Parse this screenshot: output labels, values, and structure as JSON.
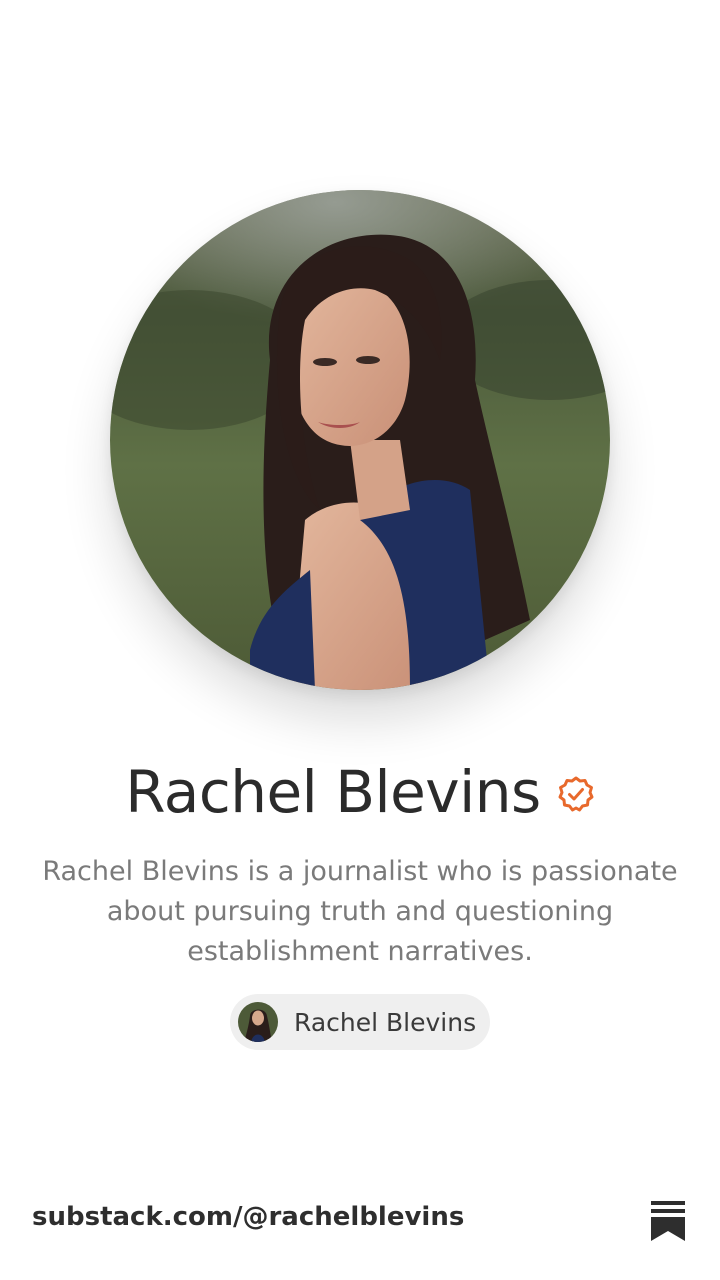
{
  "profile": {
    "name": "Rachel Blevins",
    "bio": "Rachel Blevins is a journalist who is passionate about pursuing truth and questioning establishment narratives.",
    "author_chip_label": "Rachel Blevins"
  },
  "footer": {
    "url": "substack.com/@rachelblevins"
  },
  "icons": {
    "verified": "verified-badge-icon",
    "substack": "substack-bookmark-icon"
  },
  "colors": {
    "accent": "#e8692c",
    "name_text": "#2b2b2b",
    "bio_text": "#7a7a7a",
    "pill_bg": "#efefef"
  }
}
